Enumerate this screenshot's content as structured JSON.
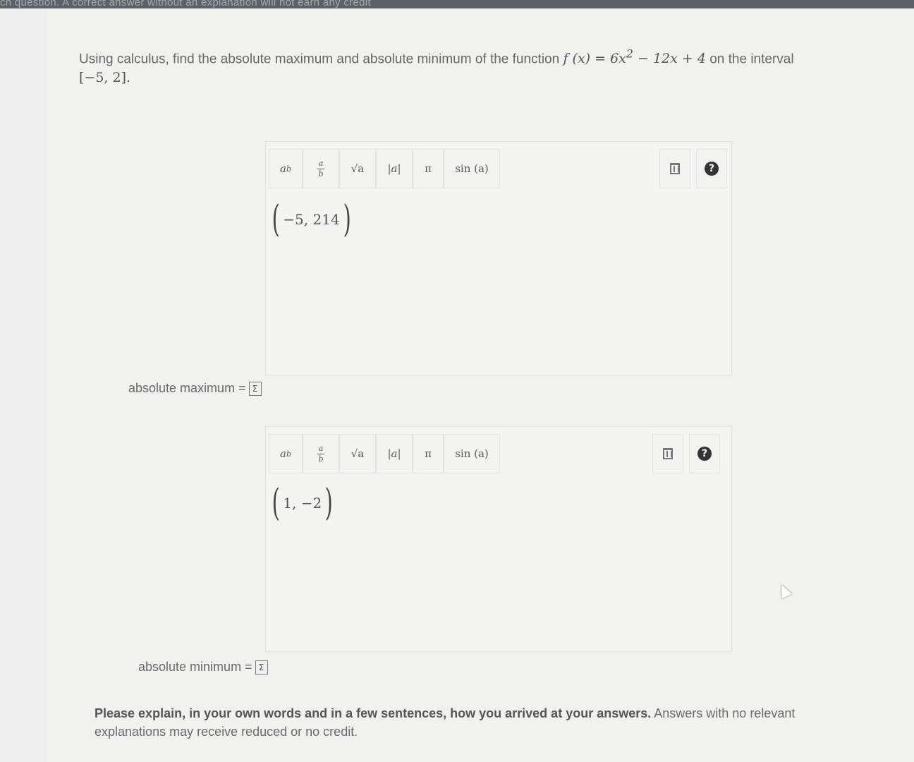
{
  "header": {
    "note": "ch question. A correct answer without an explanation will not earn any credit"
  },
  "question": {
    "text_before": "Using calculus, find the absolute maximum and absolute minimum of the function ",
    "function": "f (x) = 6x",
    "exponent": "2",
    "function_rest": " − 12x + 4",
    "text_after": " on the interval",
    "interval": "[−5, 2]."
  },
  "toolbar": {
    "power_base": "a",
    "power_exp": "b",
    "frac_num": "a",
    "frac_den": "b",
    "sqrt": "√a",
    "abs": "|a|",
    "pi": "π",
    "sin": "sin (a)",
    "delete_icon": "trash-icon",
    "help_icon": "help-icon"
  },
  "max_editor": {
    "value": "−5, 214",
    "label": "absolute maximum ="
  },
  "min_editor": {
    "value": "1, −2",
    "label": "absolute minimum ="
  },
  "sigma_symbol": "Σ",
  "explain": {
    "bold": "Please explain, in your own words and in a few sentences, how you arrived at your answers.",
    "normal": " Answers with no relevant explanations may receive reduced or no credit."
  }
}
